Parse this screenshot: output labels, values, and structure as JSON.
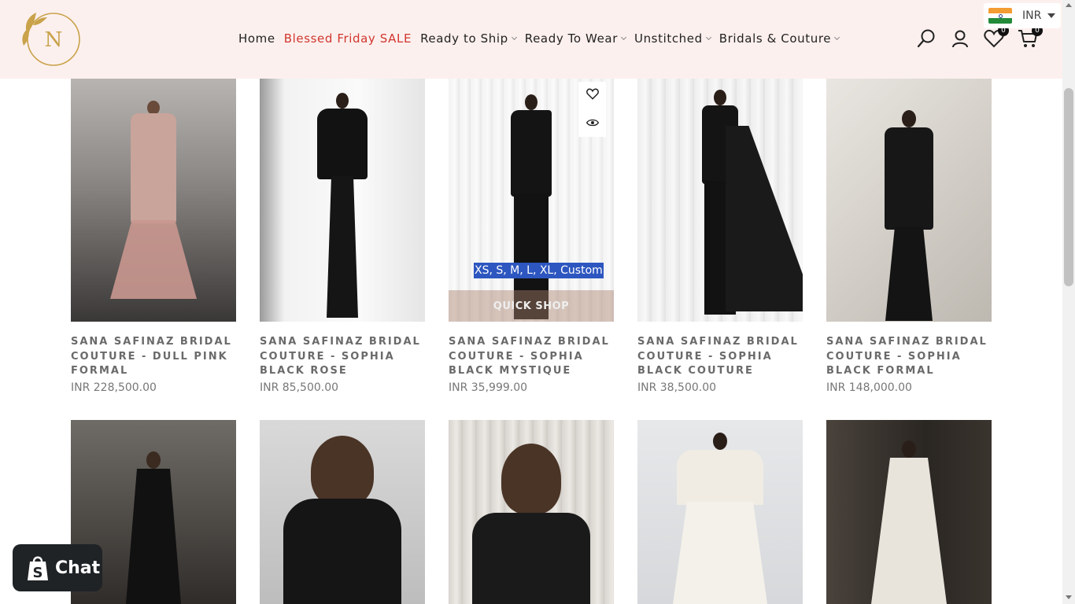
{
  "header": {
    "logo_letter": "N",
    "nav": [
      {
        "label": "Home",
        "dropdown": false,
        "sale": false
      },
      {
        "label": "Blessed Friday SALE",
        "dropdown": false,
        "sale": true
      },
      {
        "label": "Ready to Ship",
        "dropdown": true,
        "sale": false
      },
      {
        "label": "Ready To Wear",
        "dropdown": true,
        "sale": false
      },
      {
        "label": "Unstitched",
        "dropdown": true,
        "sale": false
      },
      {
        "label": "Bridals & Couture",
        "dropdown": true,
        "sale": false
      }
    ],
    "icons": [
      "search-icon",
      "account-icon",
      "wishlist-icon",
      "cart-icon"
    ],
    "wishlist_count": "0",
    "cart_count": "0",
    "currency": "INR",
    "sale_color": "#d0362e",
    "background": "#fcf0ee"
  },
  "products": [
    {
      "title": "SANA SAFINAZ BRIDAL COUTURE - DULL PINK FORMAL",
      "price": "INR 228,500.00"
    },
    {
      "title": "SANA SAFINAZ BRIDAL COUTURE - SOPHIA BLACK ROSE",
      "price": "INR 85,500.00"
    },
    {
      "title": "SANA SAFINAZ BRIDAL COUTURE - SOPHIA BLACK MYSTIQUE",
      "price": "INR 35,999.00",
      "sizes": "XS, S, M, L, XL, Custom",
      "quick_shop": "QUICK SHOP"
    },
    {
      "title": "SANA SAFINAZ BRIDAL COUTURE - SOPHIA BLACK COUTURE",
      "price": "INR 38,500.00"
    },
    {
      "title": "SANA SAFINAZ BRIDAL COUTURE - SOPHIA BLACK FORMAL",
      "price": "INR 148,000.00"
    }
  ],
  "chat": {
    "label": "Chat"
  }
}
